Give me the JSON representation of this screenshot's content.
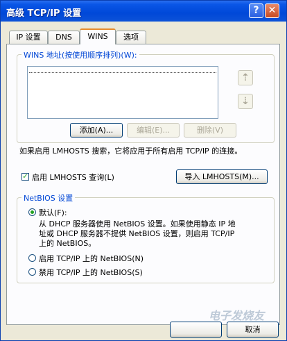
{
  "window": {
    "title": "高级 TCP/IP 设置"
  },
  "titlebar": {
    "help_glyph": "?",
    "close_glyph": "✕"
  },
  "tabs": [
    {
      "label": "IP 设置"
    },
    {
      "label": "DNS"
    },
    {
      "label": "WINS"
    },
    {
      "label": "选项"
    }
  ],
  "wins_group": {
    "legend": "WINS 地址(按使用顺序排列)(W):",
    "up_glyph": "⇡",
    "down_glyph": "⇣",
    "add_label": "添加(A)...",
    "edit_label": "编辑(E)...",
    "remove_label": "删除(V)"
  },
  "lmhosts": {
    "description": "如果启用 LMHOSTS 搜索，它将应用于所有启用 TCP/IP 的连接。",
    "checkbox_label": "启用 LMHOSTS 查询(L)",
    "checked": true,
    "check_glyph": "✓",
    "import_label": "导入 LMHOSTS(M)..."
  },
  "netbios": {
    "legend": "NetBIOS 设置",
    "options": [
      {
        "label": "默认(F):",
        "selected": true
      },
      {
        "label": "启用 TCP/IP 上的 NetBIOS(N)",
        "selected": false
      },
      {
        "label": "禁用 TCP/IP 上的 NetBIOS(S)",
        "selected": false
      }
    ],
    "default_desc_line1": "从 DHCP 服务器使用 NetBIOS 设置。如果使用静态 IP 地",
    "default_desc_line2": "址或 DHCP 服务器不提供 NetBIOS 设置，则启用 TCP/IP",
    "default_desc_line3": "上的 NetBIOS。"
  },
  "footer": {
    "cancel_label": "取消"
  },
  "watermark": {
    "text": "电子发烧友"
  }
}
